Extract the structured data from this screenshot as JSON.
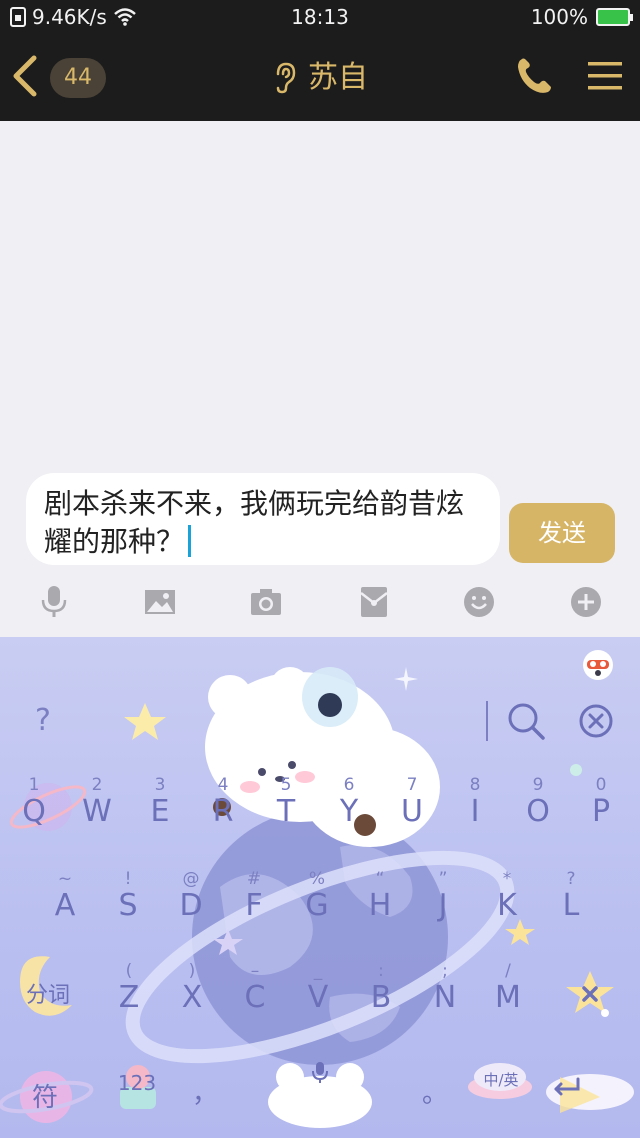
{
  "status_bar": {
    "net_speed": "9.46K/s",
    "time": "18:13",
    "battery": "100%"
  },
  "header": {
    "unread_count": "44",
    "contact_name": "苏自",
    "accent_color": "#d9b86a",
    "background_color": "#1c1c1d"
  },
  "composer": {
    "text": "剧本杀来不来，我俩玩完给韵昔炫耀的那种？",
    "send_label": "发送"
  },
  "toolbar": {
    "icons": [
      "microphone-icon",
      "image-icon",
      "camera-icon",
      "red-packet-icon",
      "emoji-icon",
      "plus-icon"
    ]
  },
  "keyboard": {
    "row1": [
      {
        "hint": "1",
        "key": "Q"
      },
      {
        "hint": "2",
        "key": "W"
      },
      {
        "hint": "3",
        "key": "E"
      },
      {
        "hint": "4",
        "key": "R"
      },
      {
        "hint": "5",
        "key": "T"
      },
      {
        "hint": "6",
        "key": "Y"
      },
      {
        "hint": "7",
        "key": "U"
      },
      {
        "hint": "8",
        "key": "I"
      },
      {
        "hint": "9",
        "key": "O"
      },
      {
        "hint": "0",
        "key": "P"
      }
    ],
    "row2": [
      {
        "hint": "~",
        "key": "A"
      },
      {
        "hint": "!",
        "key": "S"
      },
      {
        "hint": "@",
        "key": "D"
      },
      {
        "hint": "#",
        "key": "F"
      },
      {
        "hint": "%",
        "key": "G"
      },
      {
        "hint": "“",
        "key": "H"
      },
      {
        "hint": "”",
        "key": "J"
      },
      {
        "hint": "*",
        "key": "K"
      },
      {
        "hint": "?",
        "key": "L"
      }
    ],
    "row3": [
      {
        "hint": "(",
        "key": "Z"
      },
      {
        "hint": ")",
        "key": "X"
      },
      {
        "hint": "–",
        "key": "C"
      },
      {
        "hint": "_",
        "key": "V"
      },
      {
        "hint": ":",
        "key": "B"
      },
      {
        "hint": ";",
        "key": "N"
      },
      {
        "hint": "/",
        "key": "M"
      }
    ],
    "top_help": "?",
    "segment_label": "分词",
    "symbols_label": "符",
    "numbers_label": "123",
    "comma_label": "，",
    "period_label": "。",
    "lang_label": "中/英",
    "theme_color": "#c9cdf3"
  }
}
